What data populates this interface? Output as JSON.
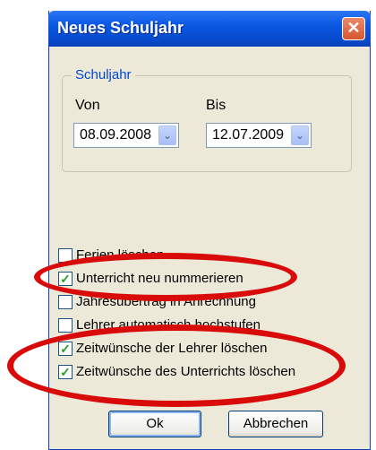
{
  "window": {
    "title": "Neues Schuljahr",
    "close_glyph": "✕"
  },
  "schuljahr": {
    "legend": "Schuljahr",
    "von_label": "Von",
    "von_value": "08.09.2008",
    "bis_label": "Bis",
    "bis_value": "12.07.2009"
  },
  "options": [
    {
      "label": "Ferien löschen",
      "checked": false
    },
    {
      "label": "Unterricht neu nummerieren",
      "checked": true
    },
    {
      "label": "Jahresübertrag in Anrechnung",
      "checked": false
    },
    {
      "label": "Lehrer automatisch hochstufen",
      "checked": false
    },
    {
      "label": "Zeitwünsche der Lehrer löschen",
      "checked": true
    },
    {
      "label": "Zeitwünsche des Unterrichts löschen",
      "checked": true
    }
  ],
  "buttons": {
    "ok": "Ok",
    "cancel": "Abbrechen"
  },
  "colors": {
    "annotation": "#d80a0a",
    "titlebar": "#0a58e2",
    "checkmark": "#21a121"
  },
  "icons": {
    "combo_arrow": "chevron-down-icon",
    "check": "checkmark-icon"
  }
}
